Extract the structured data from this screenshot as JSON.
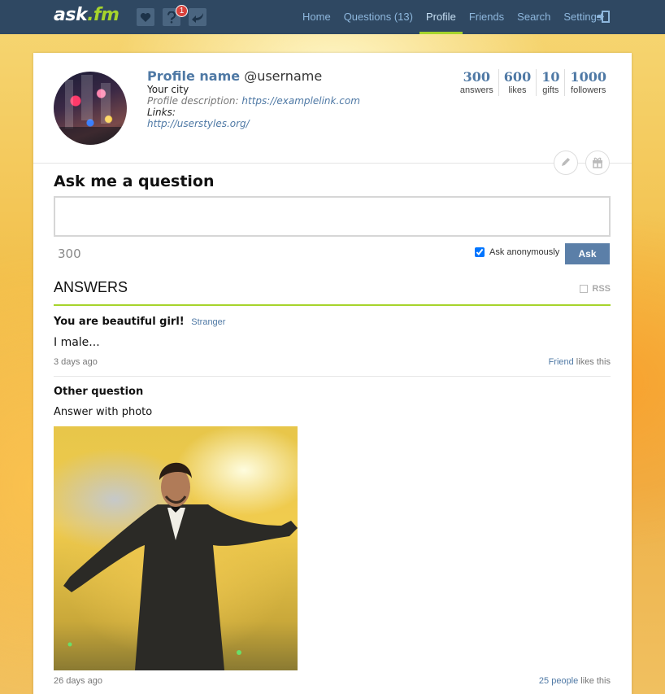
{
  "topbar": {
    "logo_main": "ask",
    "logo_suffix": ".fm",
    "icons": [
      "heart-icon",
      "question-icon",
      "reply-arrow-icon"
    ],
    "badge_count": "1",
    "nav": [
      {
        "label": "Home"
      },
      {
        "label": "Questions (13)"
      },
      {
        "label": "Profile",
        "active": true
      },
      {
        "label": "Friends"
      },
      {
        "label": "Search"
      },
      {
        "label": "Settings"
      }
    ],
    "logout_icon": "logout-icon"
  },
  "profile": {
    "name": "Profile name",
    "username": "@username",
    "city": "Your city",
    "description_label": "Profile description:",
    "description_link": "https://examplelink.com",
    "links_label": "Links:",
    "link": "http://userstyles.org/",
    "stats": [
      {
        "value": "300",
        "label": "answers"
      },
      {
        "value": "600",
        "label": "likes"
      },
      {
        "value": "10",
        "label": "gifts"
      },
      {
        "value": "1000",
        "label": "followers"
      }
    ],
    "edit_icon": "pencil-icon",
    "gift_icon": "gift-icon"
  },
  "ask": {
    "title": "Ask me a question",
    "placeholder": "",
    "char_count": "300",
    "anonymous_label": "Ask anonymously",
    "anonymous_checked": true,
    "button": "Ask"
  },
  "answers": {
    "heading": "ANSWERS",
    "rss_label": "RSS",
    "items": [
      {
        "question": "You are beautiful girl!",
        "asker": "Stranger",
        "answer": "I male...",
        "time": "3 days ago",
        "likes_who": "Friend",
        "likes_suffix": " likes this"
      },
      {
        "question": "Other question",
        "answer": "Answer with photo",
        "time": "26 days ago",
        "likes_who": "25 people",
        "likes_suffix": " like this"
      }
    ]
  },
  "colors": {
    "topbar": "#2f4862",
    "link": "#4f79a5",
    "accent_green": "#a6d42c",
    "ask_button": "#5b7fa8"
  }
}
